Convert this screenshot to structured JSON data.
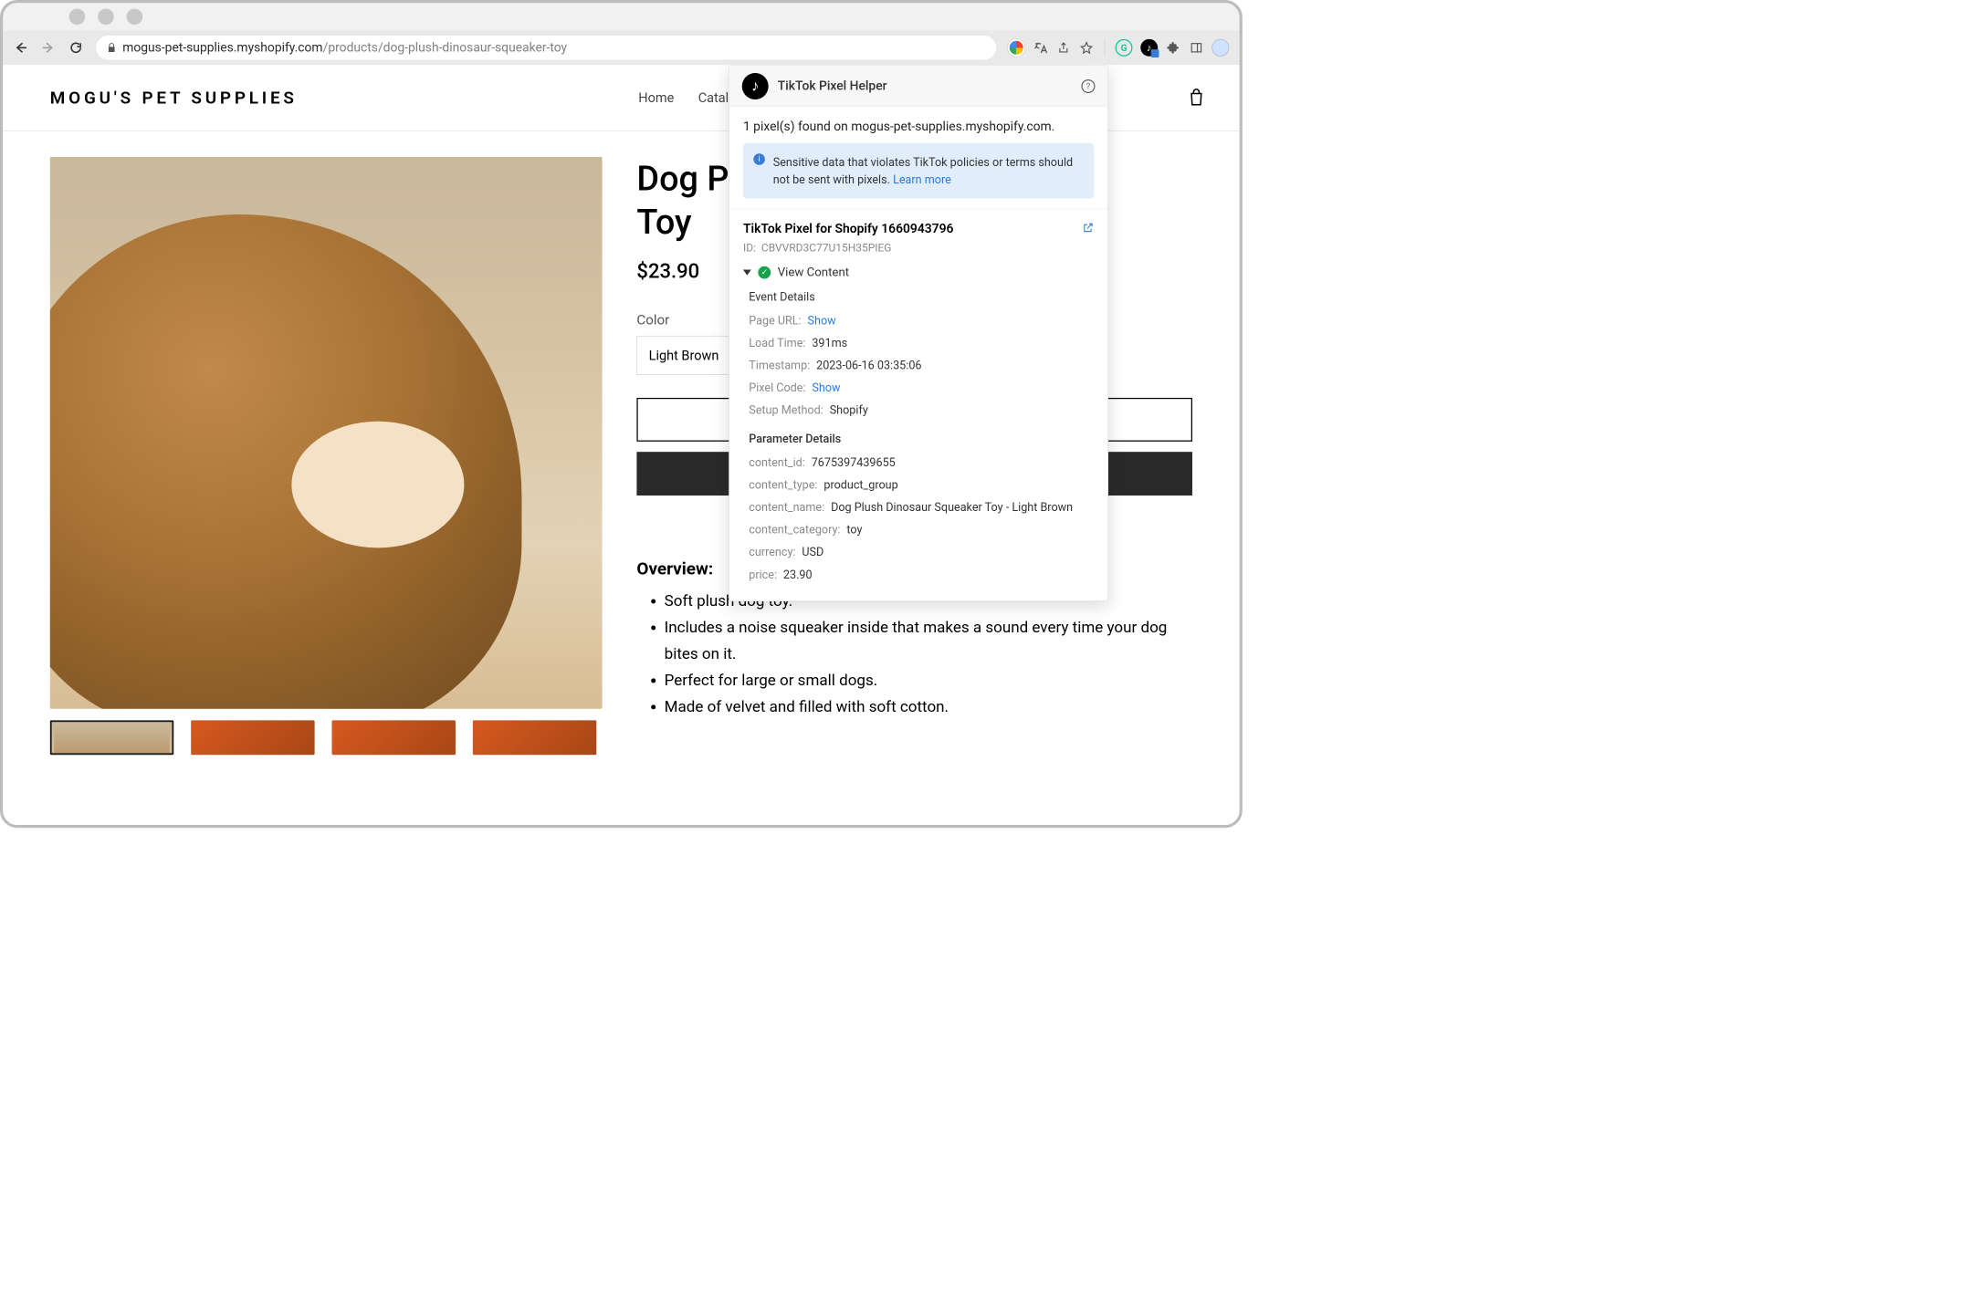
{
  "browser": {
    "url_host": "mogus-pet-supplies.myshopify.com",
    "url_path": "/products/dog-plush-dinosaur-squeaker-toy"
  },
  "store": {
    "name": "MOGU'S PET SUPPLIES",
    "nav": {
      "home": "Home",
      "catalog": "Catalog"
    }
  },
  "product": {
    "title": "Dog Plush Dinosaur Squeaker Toy",
    "title_line1": "Dog Pl",
    "title_line2": "Toy",
    "price": "$23.90",
    "color_label": "Color",
    "color_value": "Light Brown",
    "overview_heading": "Overview:",
    "overview_items": [
      "Soft plush dog toy.",
      "Includes a noise squeaker inside that makes a sound every time your dog bites on it.",
      "Perfect for large or small dogs.",
      "Made of velvet and filled with soft cotton."
    ]
  },
  "popup": {
    "title": "TikTok Pixel Helper",
    "found": "1 pixel(s) found on mogus-pet-supplies.myshopify.com.",
    "notice": "Sensitive data that violates TikTok policies or terms should not be sent with pixels.",
    "learn_more": "Learn more",
    "pixel_name": "TikTok Pixel for Shopify 1660943796",
    "id_label": "ID:",
    "pixel_id": "CBVVRD3C77U15H35PIEG",
    "event_name": "View Content",
    "event_details_heading": "Event Details",
    "param_details_heading": "Parameter Details",
    "event_details": {
      "page_url_k": "Page URL:",
      "page_url_v": "Show",
      "load_time_k": "Load Time:",
      "load_time_v": "391ms",
      "timestamp_k": "Timestamp:",
      "timestamp_v": "2023-06-16 03:35:06",
      "pixel_code_k": "Pixel Code:",
      "pixel_code_v": "Show",
      "setup_k": "Setup Method:",
      "setup_v": "Shopify"
    },
    "params": {
      "content_id_k": "content_id:",
      "content_id_v": "7675397439655",
      "content_type_k": "content_type:",
      "content_type_v": "product_group",
      "content_name_k": "content_name:",
      "content_name_v": "Dog Plush Dinosaur Squeaker Toy - Light Brown",
      "content_category_k": "content_category:",
      "content_category_v": "toy",
      "currency_k": "currency:",
      "currency_v": "USD",
      "price_k": "price:",
      "price_v": "23.90"
    }
  }
}
